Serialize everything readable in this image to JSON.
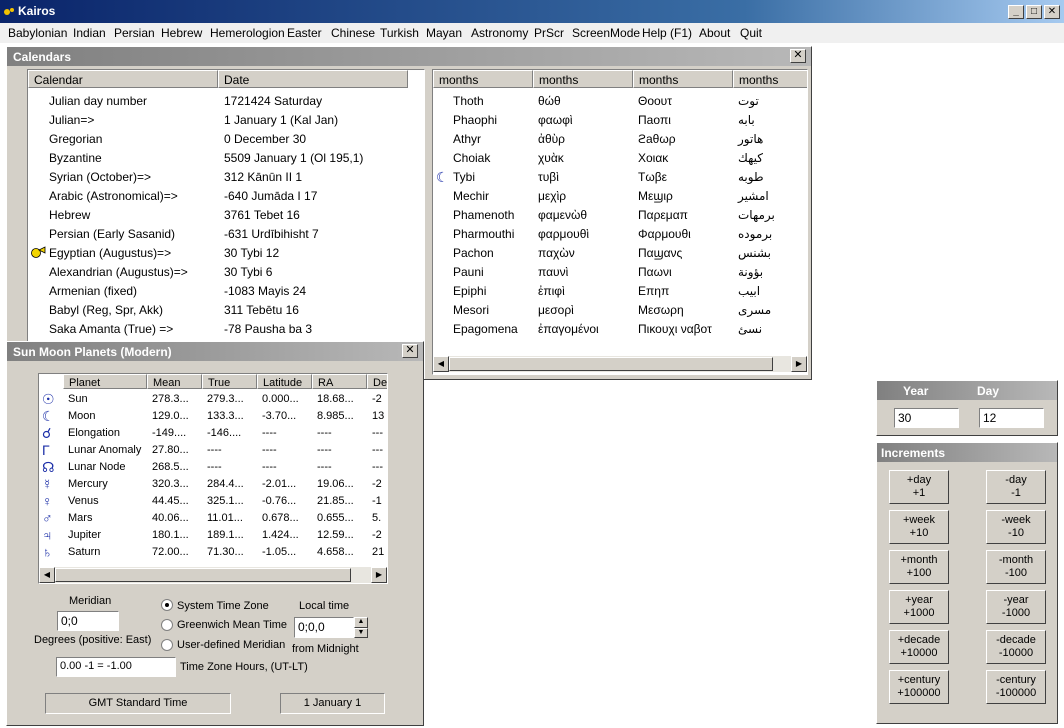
{
  "app": {
    "title": "Kairos",
    "window_controls": [
      "minimize-icon",
      "maximize-icon",
      "close-icon"
    ]
  },
  "menu": [
    "Babylonian",
    "Indian",
    "Persian",
    "Hebrew",
    "Hemerologion",
    "Easter",
    "Chinese",
    "Turkish",
    "Mayan",
    "Astronomy",
    "PrScr",
    "ScreenMode",
    "Help (F1)",
    "About",
    "Quit"
  ],
  "calendars": {
    "title": "Calendars",
    "headers": [
      "Calendar",
      "Date"
    ],
    "rows": [
      {
        "name": "Julian day number",
        "date": "1721424   Saturday"
      },
      {
        "name": "Julian=>",
        "date": "1 January 1  (Kal Jan)"
      },
      {
        "name": "Gregorian",
        "date": "0 December 30"
      },
      {
        "name": "Byzantine",
        "date": "5509 January 1 (Ol 195,1)"
      },
      {
        "name": "Syrian (October)=>",
        "date": "312 Kānūn II 1"
      },
      {
        "name": "Arabic (Astronomical)=>",
        "date": "-640 Jumāda I 17"
      },
      {
        "name": "Hebrew",
        "date": "3761 Tebet 16"
      },
      {
        "name": "Persian (Early Sasanid)",
        "date": "-631 Urdībihisht 7"
      },
      {
        "name": "Egyptian (Augustus)=>",
        "date": "30 Tybi 12"
      },
      {
        "name": "Alexandrian (Augustus)=>",
        "date": "30 Tybi 6"
      },
      {
        "name": "Armenian (fixed)",
        "date": "-1083 Mayis 24"
      },
      {
        "name": "Babyl (Reg, Spr, Akk)",
        "date": "311 Tebētu 16"
      },
      {
        "name": "Saka Amanta (True) =>",
        "date": "-78 Pausha ba 3"
      }
    ],
    "selected_marker_row": 8
  },
  "months": {
    "headers": [
      "months",
      "months",
      "months",
      "months"
    ],
    "rows": [
      [
        "Thoth",
        "θώθ",
        "Θοουτ",
        "توت"
      ],
      [
        "Phaophi",
        "φαωφὶ",
        "Πaoπι",
        "بابه"
      ],
      [
        "Athyr",
        "ἀθὺρ",
        "ϩaθωρ",
        "هاتور"
      ],
      [
        "Choiak",
        "χυὰκ",
        "Χοιακ",
        "كيهك"
      ],
      [
        "Tybi",
        "τυβὶ",
        "Τωβε",
        "طوبه"
      ],
      [
        "Mechir",
        "μεχὶρ",
        "Μεϣιρ",
        "امشير"
      ],
      [
        "Phamenoth",
        "φαμενὼθ",
        "Παρεμαπ",
        "برمهات"
      ],
      [
        "Pharmouthi",
        "φαρμουθὶ",
        "Φαρμουθι",
        "برموده"
      ],
      [
        "Pachon",
        "παχὼν",
        "Παϣανς",
        "بشنس"
      ],
      [
        "Pauni",
        "παυνὶ",
        "Παωνι",
        "بؤونة"
      ],
      [
        "Epiphi",
        "ἐπιφὶ",
        "Επηπ",
        "ابيب"
      ],
      [
        "Mesori",
        "μεσορὶ",
        "Μεσωρη",
        "مسرى"
      ],
      [
        "Epagomena",
        "ἐπαγομένοι",
        "Πικουχι ναβοτ",
        "نسئ"
      ]
    ],
    "moon_marker_row": 4
  },
  "planets": {
    "title": "Sun Moon Planets (Modern)",
    "headers": [
      "Planet",
      "Mean",
      "True",
      "Latitude",
      "RA",
      "De"
    ],
    "rows": [
      {
        "sym": "☉",
        "icon": "sun-symbol-icon",
        "name": "Sun",
        "mean": "278.3...",
        "true": "279.3...",
        "lat": "0.000...",
        "ra": "18.68...",
        "de": "-2"
      },
      {
        "sym": "☾",
        "icon": "moon-symbol-icon",
        "name": "Moon",
        "mean": "129.0...",
        "true": "133.3...",
        "lat": "-3.70...",
        "ra": "8.985...",
        "de": "13"
      },
      {
        "sym": "☌",
        "icon": "elongation-symbol-icon",
        "name": "Elongation",
        "mean": "-149....",
        "true": "-146....",
        "lat": "----",
        "ra": "----",
        "de": "---"
      },
      {
        "sym": "Γ",
        "icon": "anomaly-symbol-icon",
        "name": "Lunar Anomaly",
        "mean": "27.80...",
        "true": "----",
        "lat": "----",
        "ra": "----",
        "de": "---"
      },
      {
        "sym": "☊",
        "icon": "node-symbol-icon",
        "name": "Lunar Node",
        "mean": "268.5...",
        "true": "----",
        "lat": "----",
        "ra": "----",
        "de": "---"
      },
      {
        "sym": "☿",
        "icon": "mercury-symbol-icon",
        "name": "Mercury",
        "mean": "320.3...",
        "true": "284.4...",
        "lat": "-2.01...",
        "ra": "19.06...",
        "de": "-2"
      },
      {
        "sym": "♀",
        "icon": "venus-symbol-icon",
        "name": "Venus",
        "mean": "44.45...",
        "true": "325.1...",
        "lat": "-0.76...",
        "ra": "21.85...",
        "de": "-1"
      },
      {
        "sym": "♂",
        "icon": "mars-symbol-icon",
        "name": "Mars",
        "mean": "40.06...",
        "true": "11.01...",
        "lat": "0.678...",
        "ra": "0.655...",
        "de": "5."
      },
      {
        "sym": "♃",
        "icon": "jupiter-symbol-icon",
        "name": "Jupiter",
        "mean": "180.1...",
        "true": "189.1...",
        "lat": "1.424...",
        "ra": "12.59...",
        "de": "-2"
      },
      {
        "sym": "♄",
        "icon": "saturn-symbol-icon",
        "name": "Saturn",
        "mean": "72.00...",
        "true": "71.30...",
        "lat": "-1.05...",
        "ra": "4.658...",
        "de": "21"
      }
    ],
    "meridian_label": "Meridian",
    "meridian_value": "0;0",
    "degrees_label": "Degrees (positive: East)",
    "radio_options": [
      "System Time Zone",
      "Greenwich Mean Time",
      "User-defined Meridian"
    ],
    "radio_selected": 0,
    "local_time_label": "Local time",
    "local_time_value": "0;0,0",
    "from_midnight_label": "from Midnight",
    "tz_value": "0.00 -1 = -1.00",
    "tz_label": "Time Zone Hours, (UT-LT)",
    "status_left": "GMT Standard Time",
    "status_right": "1 January 1"
  },
  "year_day": {
    "year_label": "Year",
    "day_label": "Day",
    "year_value": "30",
    "day_value": "12"
  },
  "increments": {
    "title": "Increments",
    "buttons": [
      [
        "+day",
        "+1"
      ],
      [
        "-day",
        "-1"
      ],
      [
        "+week",
        "+10"
      ],
      [
        "-week",
        "-10"
      ],
      [
        "+month",
        "+100"
      ],
      [
        "-month",
        "-100"
      ],
      [
        "+year",
        "+1000"
      ],
      [
        "-year",
        "-1000"
      ],
      [
        "+decade",
        "+10000"
      ],
      [
        "-decade",
        "-10000"
      ],
      [
        "+century",
        "+100000"
      ],
      [
        "-century",
        "-100000"
      ]
    ]
  }
}
